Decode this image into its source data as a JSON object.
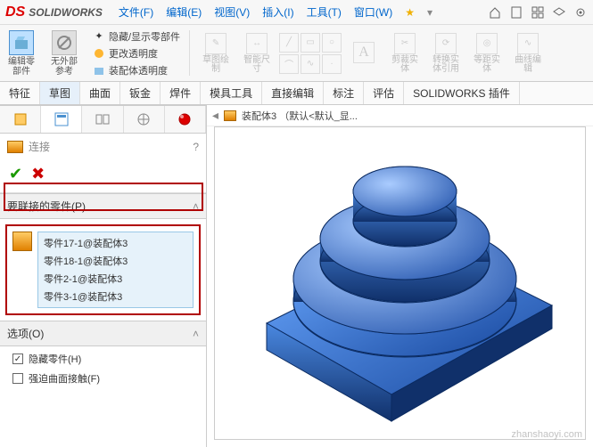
{
  "app": {
    "logo_text": "SOLIDWORKS"
  },
  "menu": {
    "file": "文件(F)",
    "edit": "编辑(E)",
    "view": "视图(V)",
    "insert": "插入(I)",
    "tools": "工具(T)",
    "window": "窗口(W)"
  },
  "menu_icons": [
    "home",
    "document",
    "grid",
    "layers",
    "gear"
  ],
  "toolbar": {
    "edit_part": "编辑零\n部件",
    "no_ext_ref": "无外部\n参考",
    "hide_show": "隐藏/显示零部件",
    "change_trans": "更改透明度",
    "assy_trans": "装配体透明度",
    "sketch": "草图绘\n制",
    "smart_dim": "智能尺\n寸",
    "trim": "剪裁实\n体",
    "convert": "转换实\n体引用",
    "equidist": "等距实\n体",
    "curve_edit": "曲线编\n辑"
  },
  "tabs": {
    "items": [
      {
        "label": "特征"
      },
      {
        "label": "草图"
      },
      {
        "label": "曲面"
      },
      {
        "label": "钣金"
      },
      {
        "label": "焊件"
      },
      {
        "label": "模具工具"
      },
      {
        "label": "直接编辑"
      },
      {
        "label": "标注"
      },
      {
        "label": "评估"
      },
      {
        "label": "SOLIDWORKS 插件"
      }
    ],
    "active_index": 1
  },
  "cmd": {
    "title": "连接",
    "section_parts": "要联接的零件(P)",
    "options_label": "选项(O)",
    "hide_parts": "隐藏零件(H)",
    "force_surface": "强迫曲面接触(F)",
    "parts_list": [
      "零件17-1@装配体3",
      "零件18-1@装配体3",
      "零件2-1@装配体3",
      "零件3-1@装配体3"
    ]
  },
  "breadcrumb": {
    "label": "装配体3 （默认<默认_显..."
  },
  "watermark": "zhanshaoyi.com"
}
